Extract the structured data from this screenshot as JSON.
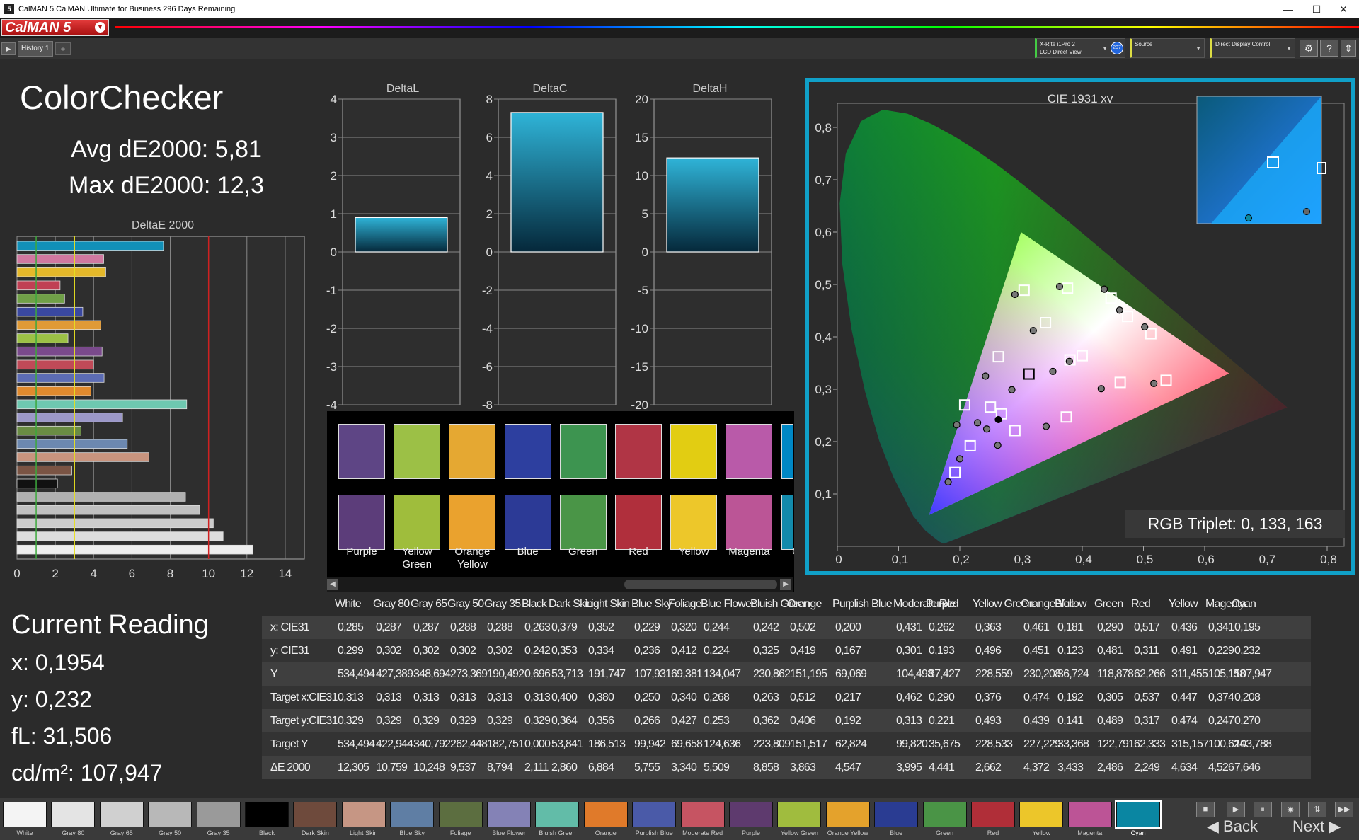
{
  "window": {
    "title": "CalMAN 5 CalMAN Ultimate for Business 296 Days Remaining",
    "icon": "5",
    "minimize": "—",
    "maximize": "☐",
    "close": "✕"
  },
  "logo": {
    "text": "CalMAN 5",
    "arrow": "▼"
  },
  "tabs": {
    "play": "▶",
    "active": "History 1",
    "add": "+"
  },
  "devices": {
    "meter_line1": "X-Rite i1Pro 2",
    "meter_line2": "LCD Direct View",
    "meter_badge": "207",
    "source": "Source",
    "display": "Direct Display Control",
    "dropdown": "▼"
  },
  "header_icons": {
    "settings": "⚙",
    "help": "?",
    "collapse": "⇕"
  },
  "summary": {
    "title": "ColorChecker",
    "avg": "Avg dE2000: 5,81",
    "max": "Max dE2000: 12,3"
  },
  "deltae_chart": {
    "title": "DeltaE 2000",
    "ticks": [
      "0",
      "2",
      "4",
      "6",
      "8",
      "10",
      "12",
      "14"
    ],
    "xmax": 15,
    "threshold_green": 1,
    "threshold_yellow": 3,
    "threshold_red": 10
  },
  "delta_charts": [
    {
      "title": "DeltaL",
      "ticks": [
        "4",
        "3",
        "2",
        "1",
        "0",
        "-1",
        "-2",
        "-3",
        "-4"
      ],
      "min": -4,
      "max": 4,
      "value": 0.9
    },
    {
      "title": "DeltaC",
      "ticks": [
        "8",
        "6",
        "4",
        "2",
        "0",
        "-2",
        "-4",
        "-6",
        "-8"
      ],
      "min": -8,
      "max": 8,
      "value": 7.3
    },
    {
      "title": "DeltaH",
      "ticks": [
        "20",
        "15",
        "10",
        "5",
        "0",
        "-5",
        "-10",
        "-15",
        "-20"
      ],
      "min": -20,
      "max": 20,
      "value": 12.3
    }
  ],
  "swatch_strip": [
    {
      "label": "Purple",
      "actual": "#5e4585",
      "target": "#5c3d7a"
    },
    {
      "label": "Yellow Green",
      "actual": "#9cc046",
      "target": "#9fbd3c"
    },
    {
      "label": "Orange Yellow",
      "actual": "#e5a832",
      "target": "#eaa22e"
    },
    {
      "label": "Blue",
      "actual": "#2d3f9f",
      "target": "#2c3a96"
    },
    {
      "label": "Green",
      "actual": "#3d9450",
      "target": "#4a9547"
    },
    {
      "label": "Red",
      "actual": "#b03545",
      "target": "#b02f3c"
    },
    {
      "label": "Yellow",
      "actual": "#e2cd12",
      "target": "#edc72a"
    },
    {
      "label": "Magenta",
      "actual": "#b95aa9",
      "target": "#bb5596"
    },
    {
      "label": "Cyan",
      "actual": "#0087c4",
      "target": "#138aab"
    }
  ],
  "scroll": {
    "left": "◀",
    "right": "▶"
  },
  "cie": {
    "title": "CIE 1931 xy",
    "xticks": [
      "0",
      "0,1",
      "0,2",
      "0,3",
      "0,4",
      "0,5",
      "0,6",
      "0,7",
      "0,8"
    ],
    "yticks": [
      "0,1",
      "0,2",
      "0,3",
      "0,4",
      "0,5",
      "0,6",
      "0,7",
      "0,8"
    ],
    "triplet": "RGB Triplet: 0, 133, 163",
    "measured": [
      [
        0.285,
        0.299
      ],
      [
        0.263,
        0.242
      ],
      [
        0.379,
        0.353
      ],
      [
        0.352,
        0.334
      ],
      [
        0.229,
        0.236
      ],
      [
        0.32,
        0.412
      ],
      [
        0.244,
        0.224
      ],
      [
        0.242,
        0.325
      ],
      [
        0.502,
        0.419
      ],
      [
        0.2,
        0.167
      ],
      [
        0.431,
        0.301
      ],
      [
        0.262,
        0.193
      ],
      [
        0.363,
        0.496
      ],
      [
        0.461,
        0.451
      ],
      [
        0.181,
        0.123
      ],
      [
        0.29,
        0.481
      ],
      [
        0.517,
        0.311
      ],
      [
        0.436,
        0.491
      ],
      [
        0.341,
        0.229
      ],
      [
        0.195,
        0.232
      ]
    ],
    "targets": [
      [
        0.313,
        0.329
      ],
      [
        0.4,
        0.364
      ],
      [
        0.38,
        0.356
      ],
      [
        0.25,
        0.266
      ],
      [
        0.34,
        0.427
      ],
      [
        0.268,
        0.253
      ],
      [
        0.263,
        0.362
      ],
      [
        0.512,
        0.406
      ],
      [
        0.217,
        0.192
      ],
      [
        0.462,
        0.313
      ],
      [
        0.29,
        0.221
      ],
      [
        0.376,
        0.493
      ],
      [
        0.474,
        0.439
      ],
      [
        0.192,
        0.141
      ],
      [
        0.305,
        0.489
      ],
      [
        0.537,
        0.317
      ],
      [
        0.447,
        0.474
      ],
      [
        0.374,
        0.247
      ],
      [
        0.208,
        0.27
      ]
    ],
    "gamut": [
      [
        0.64,
        0.33
      ],
      [
        0.3,
        0.6
      ],
      [
        0.15,
        0.06
      ]
    ]
  },
  "current": {
    "title": "Current Reading",
    "x": "x: 0,1954",
    "y": "y: 0,232",
    "fl": "fL: 31,506",
    "cdm2": "cd/m²: 107,947"
  },
  "table": {
    "headers": [
      "White",
      "Gray 80",
      "Gray 65",
      "Gray 50",
      "Gray 35",
      "Black",
      "Dark Skin",
      "Light Skin",
      "Blue Sky",
      "Foliage",
      "Blue Flower",
      "Bluish Green",
      "Orange",
      "Purplish Blue",
      "Moderate Red",
      "Purple",
      "Yellow Green",
      "Orange Yellow",
      "Blue",
      "Green",
      "Red",
      "Yellow",
      "Magenta",
      "Cyan"
    ],
    "rows": [
      {
        "label": "x: CIE31",
        "values": [
          "0,285",
          "0,287",
          "0,287",
          "0,288",
          "0,288",
          "0,263",
          "0,379",
          "0,352",
          "0,229",
          "0,320",
          "0,244",
          "0,242",
          "0,502",
          "0,200",
          "0,431",
          "0,262",
          "0,363",
          "0,461",
          "0,181",
          "0,290",
          "0,517",
          "0,436",
          "0,341",
          "0,195"
        ]
      },
      {
        "label": "y: CIE31",
        "values": [
          "0,299",
          "0,302",
          "0,302",
          "0,302",
          "0,302",
          "0,242",
          "0,353",
          "0,334",
          "0,236",
          "0,412",
          "0,224",
          "0,325",
          "0,419",
          "0,167",
          "0,301",
          "0,193",
          "0,496",
          "0,451",
          "0,123",
          "0,481",
          "0,311",
          "0,491",
          "0,229",
          "0,232"
        ]
      },
      {
        "label": "Y",
        "values": [
          "534,494",
          "427,389",
          "348,694",
          "273,369",
          "190,492",
          "0,696",
          "53,713",
          "191,747",
          "107,931",
          "69,381",
          "134,047",
          "230,862",
          "151,195",
          "69,069",
          "104,498",
          "37,427",
          "228,559",
          "230,208",
          "36,724",
          "118,878",
          "62,266",
          "311,455",
          "105,158",
          "107,947"
        ]
      },
      {
        "label": "Target x:CIE31",
        "values": [
          "0,313",
          "0,313",
          "0,313",
          "0,313",
          "0,313",
          "0,313",
          "0,400",
          "0,380",
          "0,250",
          "0,340",
          "0,268",
          "0,263",
          "0,512",
          "0,217",
          "0,462",
          "0,290",
          "0,376",
          "0,474",
          "0,192",
          "0,305",
          "0,537",
          "0,447",
          "0,374",
          "0,208"
        ]
      },
      {
        "label": "Target y:CIE31",
        "values": [
          "0,329",
          "0,329",
          "0,329",
          "0,329",
          "0,329",
          "0,329",
          "0,364",
          "0,356",
          "0,266",
          "0,427",
          "0,253",
          "0,362",
          "0,406",
          "0,192",
          "0,313",
          "0,221",
          "0,493",
          "0,439",
          "0,141",
          "0,489",
          "0,317",
          "0,474",
          "0,247",
          "0,270"
        ]
      },
      {
        "label": "Target Y",
        "values": [
          "534,494",
          "422,944",
          "340,792",
          "262,448",
          "182,751",
          "0,000",
          "53,841",
          "186,513",
          "99,942",
          "69,658",
          "124,636",
          "223,809",
          "151,517",
          "62,824",
          "99,820",
          "35,675",
          "228,533",
          "227,229",
          "33,368",
          "122,791",
          "62,333",
          "315,157",
          "100,624",
          "103,788"
        ]
      },
      {
        "label": "ΔE 2000",
        "values": [
          "12,305",
          "10,759",
          "10,248",
          "9,537",
          "8,794",
          "2,111",
          "2,860",
          "6,884",
          "5,755",
          "3,340",
          "5,509",
          "8,858",
          "3,863",
          "4,547",
          "3,995",
          "4,441",
          "2,662",
          "4,372",
          "3,433",
          "2,486",
          "2,249",
          "4,634",
          "4,526",
          "7,646"
        ]
      }
    ]
  },
  "bottom_swatches": [
    {
      "label": "White",
      "color": "#f4f4f4"
    },
    {
      "label": "Gray 80",
      "color": "#e4e4e4"
    },
    {
      "label": "Gray 65",
      "color": "#d0d0d0"
    },
    {
      "label": "Gray 50",
      "color": "#b8b8b8"
    },
    {
      "label": "Gray 35",
      "color": "#9a9a9a"
    },
    {
      "label": "Black",
      "color": "#000000"
    },
    {
      "label": "Dark Skin",
      "color": "#6e4a3c"
    },
    {
      "label": "Light Skin",
      "color": "#c69684"
    },
    {
      "label": "Blue Sky",
      "color": "#5f7ea4"
    },
    {
      "label": "Foliage",
      "color": "#5c6e40"
    },
    {
      "label": "Blue Flower",
      "color": "#8482b6"
    },
    {
      "label": "Bluish Green",
      "color": "#62bca8"
    },
    {
      "label": "Orange",
      "color": "#e07a2a"
    },
    {
      "label": "Purplish Blue",
      "color": "#4a5aa8"
    },
    {
      "label": "Moderate Red",
      "color": "#c65462"
    },
    {
      "label": "Purple",
      "color": "#5e3a6e"
    },
    {
      "label": "Yellow Green",
      "color": "#a0bc3e"
    },
    {
      "label": "Orange Yellow",
      "color": "#e4a22c"
    },
    {
      "label": "Blue",
      "color": "#2a3c92"
    },
    {
      "label": "Green",
      "color": "#4a9446"
    },
    {
      "label": "Red",
      "color": "#b02e38"
    },
    {
      "label": "Yellow",
      "color": "#ecc62a"
    },
    {
      "label": "Magenta",
      "color": "#bc5496"
    },
    {
      "label": "Cyan",
      "color": "#0a86a2"
    }
  ],
  "bar_colors": [
    "#1190b8",
    "#d078a0",
    "#e4b82a",
    "#c04054",
    "#70a048",
    "#3a48a0",
    "#e09a36",
    "#9cc046",
    "#7a4a8c",
    "#c04a58",
    "#5c6cb4",
    "#e08a2e",
    "#6ec8b0",
    "#9c98c8",
    "#6a8c44",
    "#6c88b0",
    "#c8947e",
    "#7a5444",
    "#111111",
    "#b0b0b0",
    "#c0c0c0",
    "#cccccc",
    "#dddddd",
    "#eeeeee"
  ],
  "active_bottom": "Cyan",
  "nav": {
    "back": "◀ Back",
    "next": "Next ▶"
  },
  "controls": [
    "■",
    "▶",
    "⏸",
    "◉",
    "⇅",
    "▶▶"
  ]
}
